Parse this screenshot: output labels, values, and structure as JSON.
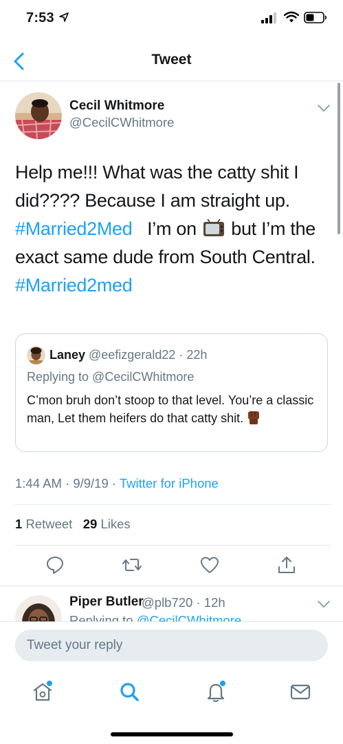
{
  "status_bar": {
    "time": "7:53",
    "icons": [
      "location-arrow-icon",
      "cellular-signal-icon",
      "wifi-icon",
      "battery-icon"
    ]
  },
  "nav": {
    "title": "Tweet",
    "back_icon": "chevron-left-icon"
  },
  "tweet": {
    "author_name": "Cecil Whitmore",
    "author_handle": "@CecilCWhitmore",
    "lines": [
      "Help me!!!  What was the catty shit I",
      "did????  Because I am straight up.",
      "#Married2Med",
      "I’m on",
      "but I’m the",
      "exact same dude from South Central.",
      "#Married2med"
    ],
    "emoji": "tv-emoji",
    "timestamp": "1:44 AM · 9/9/19 · ",
    "source": "Twitter for iPhone",
    "retweet_count": "1",
    "retweet_label": "Retweet",
    "like_count": "29",
    "like_label": "Likes"
  },
  "quoted_tweet": {
    "name": "Laney",
    "meta": "@eefizgerald22 · 22h",
    "replying_to": "Replying to @CecilCWhitmore",
    "text": "C’mon bruh don’t stoop to that level. You’re a classic man, Let them heifers do that catty shit.",
    "emoji": "raised-fist-emoji"
  },
  "actions": [
    "reply-icon",
    "retweet-icon",
    "like-icon",
    "share-icon"
  ],
  "reply_preview": {
    "name": "Piper Butler",
    "meta": "@plb720 · 12h",
    "replying_prefix": "Replying to ",
    "replying_handle": "@CecilCWhitmore"
  },
  "composer": {
    "placeholder": "Tweet your reply"
  },
  "tab_bar": [
    "home-icon",
    "search-icon",
    "notifications-icon",
    "messages-icon"
  ],
  "colors": {
    "accent": "#1da1f2",
    "secondary_text": "#657786",
    "primary_text": "#14171a",
    "divider": "#e1e8ed"
  }
}
